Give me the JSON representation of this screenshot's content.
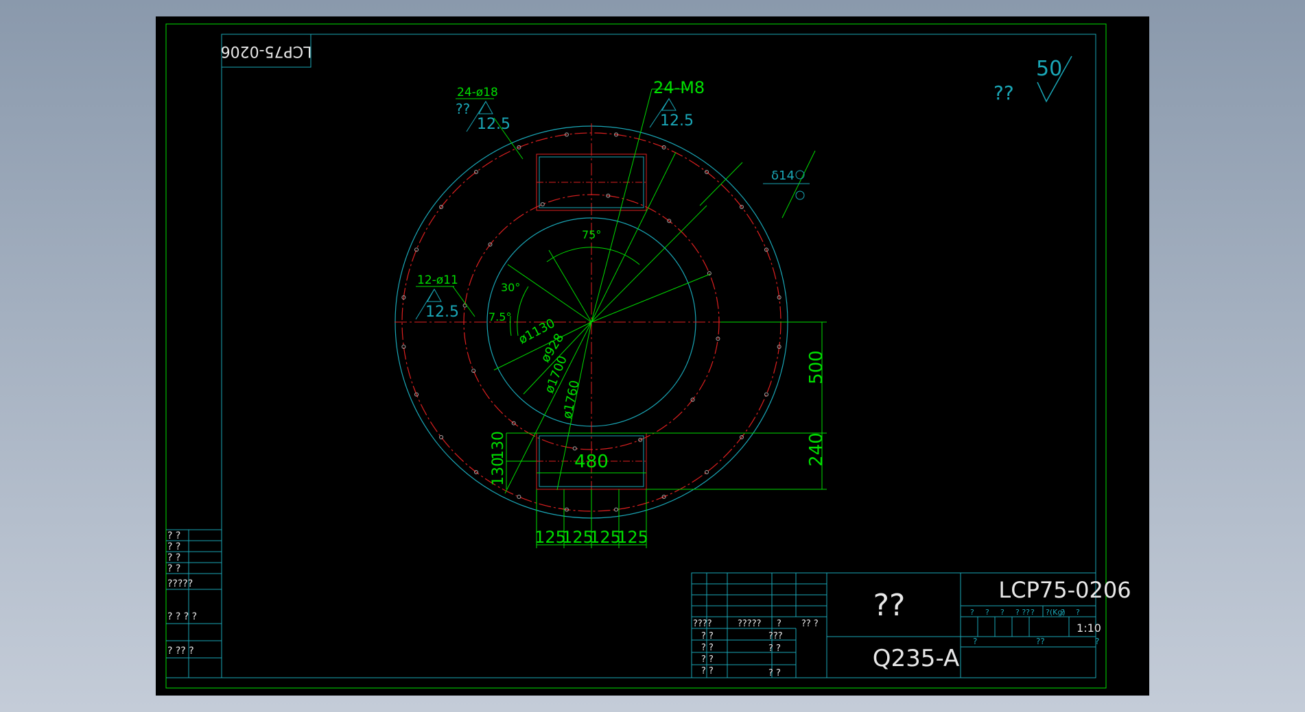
{
  "colors": {
    "border": "#00e000",
    "cyan": "#1aa8b8",
    "red": "#e02020",
    "dim": "#00e000",
    "text": "#00e000",
    "white": "#e8e8e8",
    "viewport_bg": "#000000"
  },
  "drawing": {
    "number": "LCP75-0206",
    "number_mirrored": "LCP75-0206",
    "roughness_all": "50",
    "roughness_note": "??",
    "material": "Q235-A",
    "part_name": "??",
    "scale": "1:10",
    "thickness": "δ14"
  },
  "annotations": {
    "holes_top": "24-ø18",
    "holes_top_note": "??",
    "holes_top_ra": "12.5",
    "threads": "24-M8",
    "threads_ra": "12.5",
    "holes_left": "12-ø11",
    "holes_left_ra": "12.5",
    "angle_75": "75°",
    "angle_30": "30°",
    "angle_7_5": "7.5°",
    "dia_1130": "ø1130",
    "dia_928": "ø928",
    "dia_1700": "ø1700",
    "dia_1760": "ø1760",
    "dim_500": "500",
    "dim_240": "240",
    "dim_480": "480",
    "dim_130a": "130",
    "dim_130b": "130",
    "dim_125a": "125",
    "dim_125b": "125",
    "dim_125c": "125",
    "dim_125d": "125"
  },
  "left_column": {
    "rows": [
      "? ?",
      "? ?",
      "? ?",
      "? ?",
      "?????",
      "? ? ? ?",
      "? ??    ?"
    ]
  },
  "title_block": {
    "row_labels": [
      "????",
      "?????",
      "?",
      "??  ?"
    ],
    "cells_a": [
      "? ?",
      "? ?",
      "? ?",
      "? ?"
    ],
    "cells_b": [
      "???",
      "? ?",
      "? ?"
    ],
    "info_row": [
      "?",
      "?",
      "?",
      "? ??",
      "?",
      "?(Kg)",
      "?",
      "?"
    ],
    "bottom_row": [
      "?",
      "??",
      "?"
    ]
  }
}
